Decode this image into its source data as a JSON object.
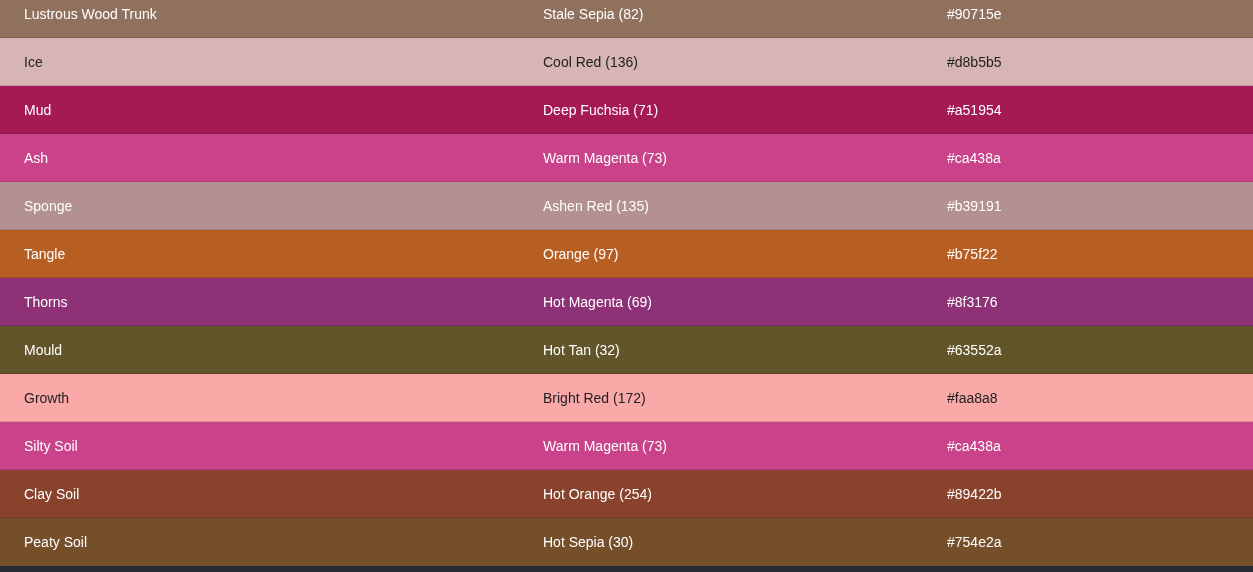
{
  "rows": [
    {
      "name": "Lustrous Wood Trunk",
      "color_name": "Stale Sepia (82)",
      "hex": "#90715e",
      "color": "#90715e"
    },
    {
      "name": "Ice",
      "color_name": "Cool Red (136)",
      "hex": "#d8b5b5",
      "color": "#d8b5b5"
    },
    {
      "name": "Mud",
      "color_name": "Deep Fuchsia (71)",
      "hex": "#a51954",
      "color": "#a51954"
    },
    {
      "name": "Ash",
      "color_name": "Warm Magenta (73)",
      "hex": "#ca438a",
      "color": "#ca438a"
    },
    {
      "name": "Sponge",
      "color_name": "Ashen Red (135)",
      "hex": "#b39191",
      "color": "#b39191"
    },
    {
      "name": "Tangle",
      "color_name": "Orange (97)",
      "hex": "#b75f22",
      "color": "#b75f22"
    },
    {
      "name": "Thorns",
      "color_name": "Hot Magenta (69)",
      "hex": "#8f3176",
      "color": "#8f3176"
    },
    {
      "name": "Mould",
      "color_name": "Hot Tan (32)",
      "hex": "#63552a",
      "color": "#63552a"
    },
    {
      "name": "Growth",
      "color_name": "Bright Red (172)",
      "hex": "#faa8a8",
      "color": "#faa8a8"
    },
    {
      "name": "Silty Soil",
      "color_name": "Warm Magenta (73)",
      "hex": "#ca438a",
      "color": "#ca438a"
    },
    {
      "name": "Clay Soil",
      "color_name": "Hot Orange (254)",
      "hex": "#89422b",
      "color": "#89422b"
    },
    {
      "name": "Peaty Soil",
      "color_name": "Hot Sepia (30)",
      "hex": "#754e2a",
      "color": "#754e2a"
    }
  ]
}
